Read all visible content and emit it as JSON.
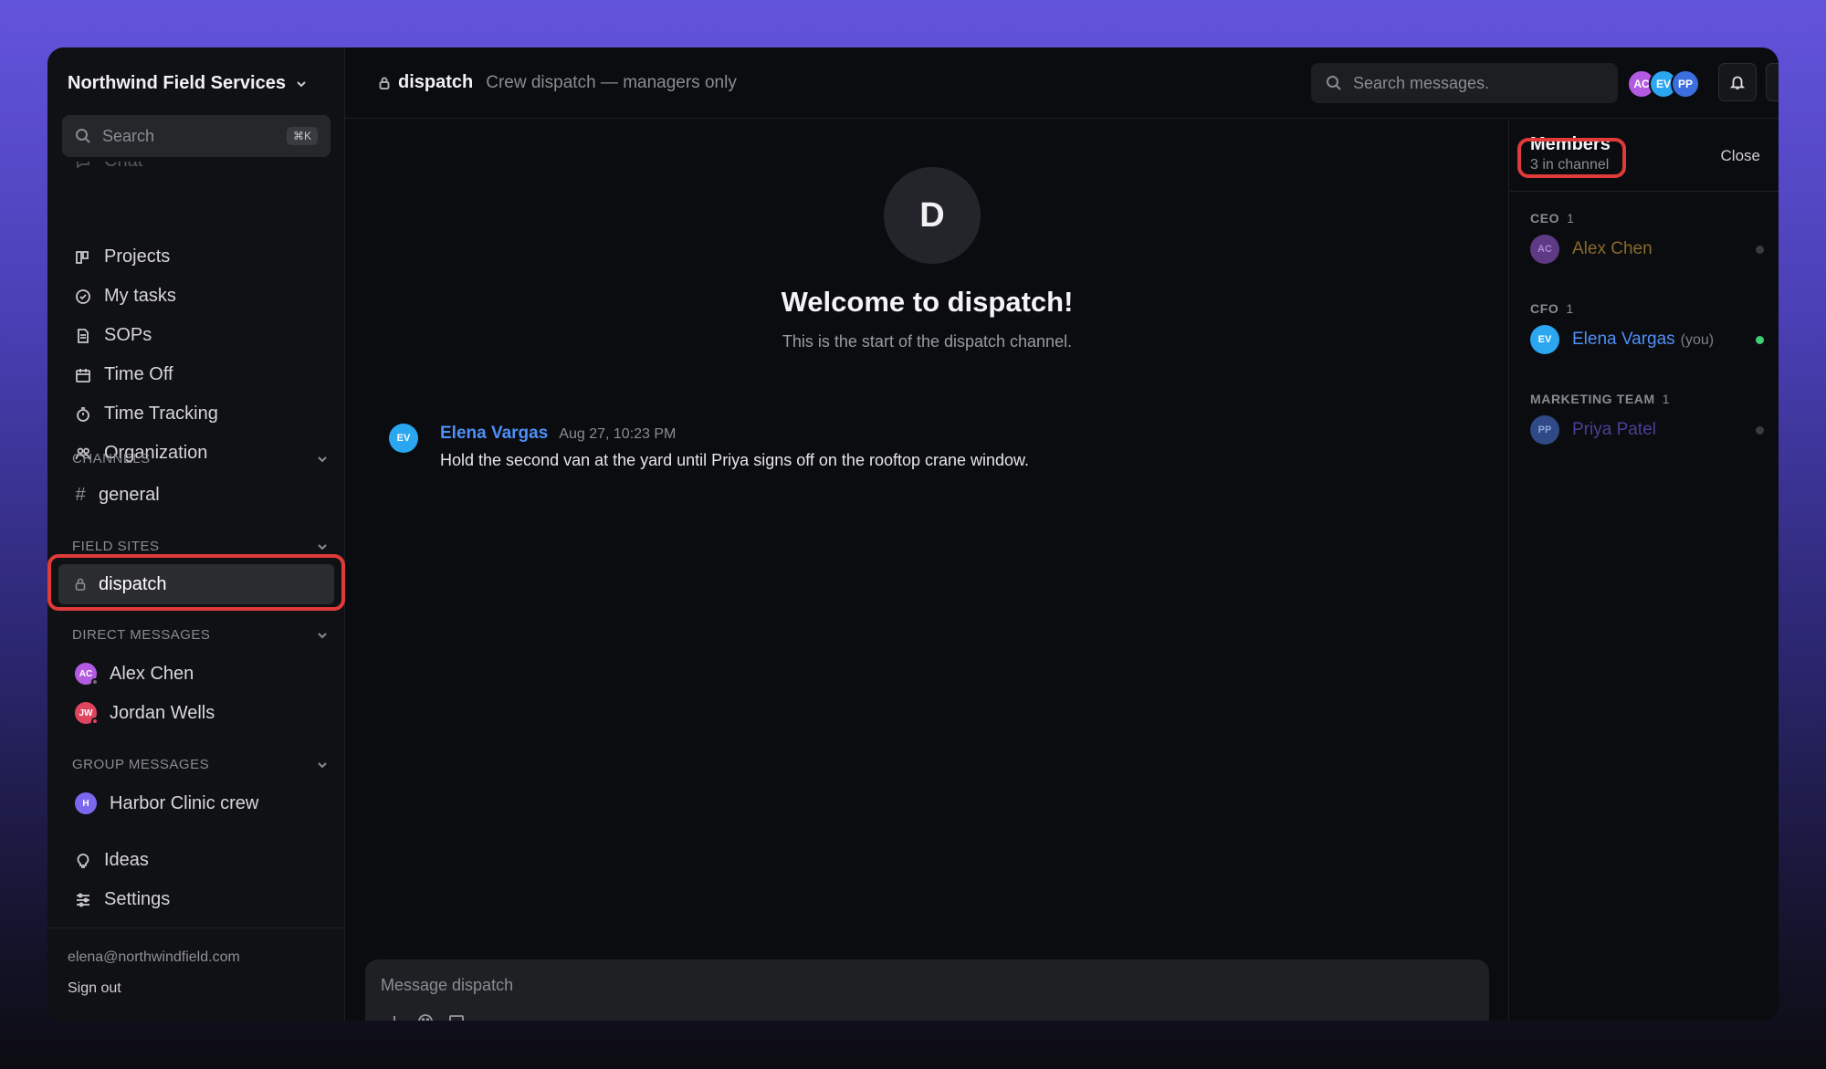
{
  "workspace": {
    "name": "Northwind Field Services"
  },
  "sidebar": {
    "search_placeholder": "Search",
    "search_shortcut": "⌘K",
    "faded_item": "Chat",
    "nav": [
      {
        "label": "Projects",
        "icon": "columns-icon"
      },
      {
        "label": "My tasks",
        "icon": "check-circle-icon"
      },
      {
        "label": "SOPs",
        "icon": "document-icon"
      },
      {
        "label": "Time Off",
        "icon": "calendar-icon"
      },
      {
        "label": "Time Tracking",
        "icon": "stopwatch-icon"
      },
      {
        "label": "Organization",
        "icon": "people-icon"
      }
    ],
    "sections": {
      "channels": "CHANNELS",
      "field_sites": "FIELD SITES",
      "direct_messages": "DIRECT MESSAGES",
      "group_messages": "GROUP MESSAGES"
    },
    "channels": [
      {
        "prefix": "#",
        "label": "general"
      }
    ],
    "field_sites": [
      {
        "label": "dispatch",
        "active": true
      }
    ],
    "direct_messages": [
      {
        "initials": "AC",
        "label": "Alex Chen",
        "color": "#b25be0",
        "status_color": "#6b6c72"
      },
      {
        "initials": "JW",
        "label": "Jordan Wells",
        "color": "#e0455f",
        "status_color": "#e0455f"
      }
    ],
    "group_messages": [
      {
        "initials": "H",
        "label": "Harbor Clinic crew",
        "color": "#7b68ee"
      }
    ],
    "bottom": [
      {
        "label": "Ideas",
        "icon": "lightbulb-icon"
      },
      {
        "label": "Settings",
        "icon": "sliders-icon"
      }
    ],
    "email": "elena@northwindfield.com",
    "signout": "Sign out"
  },
  "header": {
    "channel": "dispatch",
    "description": "Crew dispatch — managers only",
    "search_placeholder": "Search messages.",
    "avatars": [
      {
        "initials": "AC",
        "color": "#b25be0"
      },
      {
        "initials": "EV",
        "color": "#2aa7f0"
      },
      {
        "initials": "PP",
        "color": "#3b6fe0"
      }
    ],
    "help": "?"
  },
  "chat": {
    "big_initial": "D",
    "welcome": "Welcome to dispatch!",
    "welcome_sub": "This is the start of the dispatch channel.",
    "messages": [
      {
        "initials": "EV",
        "author": "Elena Vargas",
        "time": "Aug 27, 10:23 PM",
        "text": "Hold the second van at the yard until Priya signs off on the rooftop crane window."
      }
    ],
    "composer_placeholder": "Message dispatch"
  },
  "members": {
    "title": "Members",
    "count": "3 in channel",
    "close": "Close",
    "groups": [
      {
        "role": "CEO",
        "count": "1",
        "member": {
          "initials": "AC",
          "name": "Alex Chen",
          "color": "#5e3a84",
          "name_color": "#8a6a2a",
          "status": "#3a3b40"
        }
      },
      {
        "role": "CFO",
        "count": "1",
        "member": {
          "initials": "EV",
          "name": "Elena Vargas",
          "suffix": "(you)",
          "color": "#2aa7f0",
          "name_color": "#4f8ff7",
          "status": "#3ecf75"
        }
      },
      {
        "role": "MARKETING TEAM",
        "count": "1",
        "member": {
          "initials": "PP",
          "name": "Priya Patel",
          "color": "#2f4a86",
          "name_color": "#4a3f9a",
          "status": "#3a3b40"
        }
      }
    ]
  }
}
